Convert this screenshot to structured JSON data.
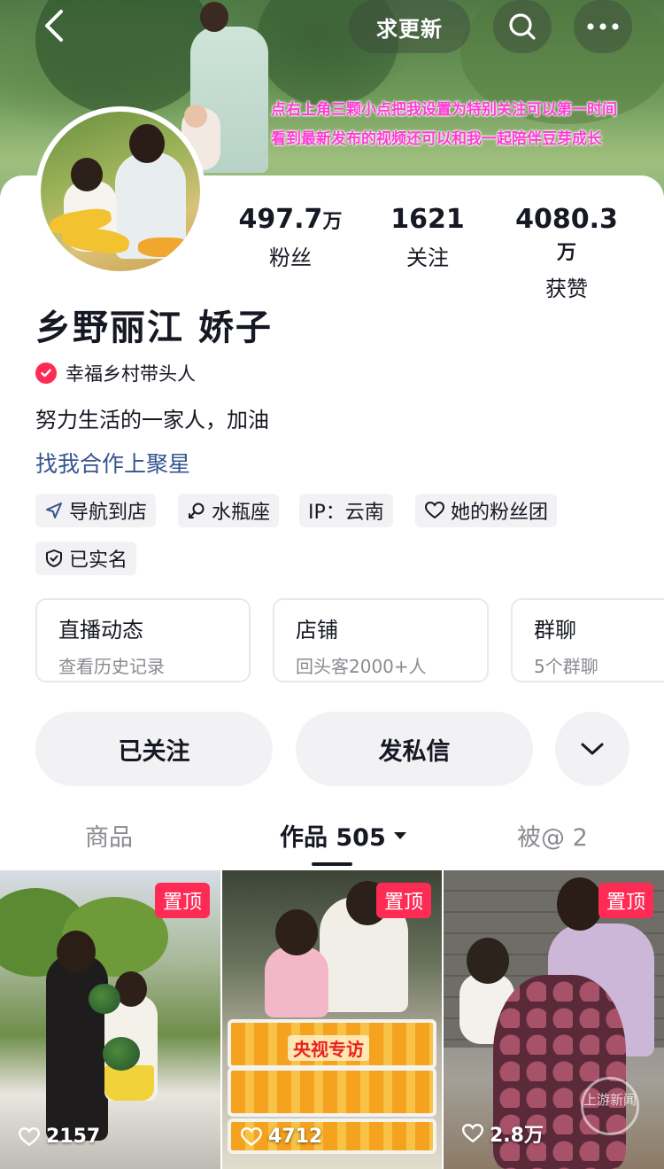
{
  "header": {
    "update_button": "求更新",
    "caption_line1": "点右上角三颗小点把我设置为特别关注可以第一时间",
    "caption_line2": "看到最新发布的视频还可以和我一起陪伴豆芽成长"
  },
  "stats": {
    "fans_num": "497.7",
    "fans_unit": "万",
    "fans_label": "粉丝",
    "following_num": "1621",
    "following_label": "关注",
    "likes_num": "4080.3",
    "likes_unit": "万",
    "likes_label": "获赞"
  },
  "profile": {
    "name": "乡野丽江 娇子",
    "verified_text": "幸福乡村带头人",
    "bio": "努力生活的一家人，加油",
    "cooperation_link": "找我合作上聚星"
  },
  "tags": {
    "navigate": "导航到店",
    "zodiac": "水瓶座",
    "ip": "IP：云南",
    "fan_club": "她的粉丝团",
    "real_name": "已实名"
  },
  "features": [
    {
      "title": "直播动态",
      "subtitle": "查看历史记录"
    },
    {
      "title": "店铺",
      "subtitle": "回头客2000+人"
    },
    {
      "title": "群聊",
      "subtitle": "5个群聊"
    }
  ],
  "actions": {
    "follow": "已关注",
    "message": "发私信"
  },
  "tabs": {
    "goods": "商品",
    "works": "作品 505",
    "mentions": "被@ 2"
  },
  "videos": [
    {
      "pinned": "置顶",
      "likes": "2157"
    },
    {
      "pinned": "置顶",
      "likes": "4712",
      "overlay_text": "央视专访"
    },
    {
      "pinned": "置顶",
      "likes": "2.8万",
      "watermark": "上游新闻"
    }
  ],
  "colors": {
    "accent": "#fe2c55",
    "link": "#35548e",
    "caption": "#ff3bd4"
  },
  "icons": {
    "back": "chevron-left-icon",
    "search": "search-icon",
    "more": "more-dots-icon",
    "verified": "check-badge-icon",
    "navigate": "navigation-arrow-icon",
    "zodiac": "zodiac-icon",
    "fan_club": "heart-outline-icon",
    "real_name": "shield-icon",
    "dropdown": "chevron-down-icon",
    "like": "heart-icon"
  }
}
